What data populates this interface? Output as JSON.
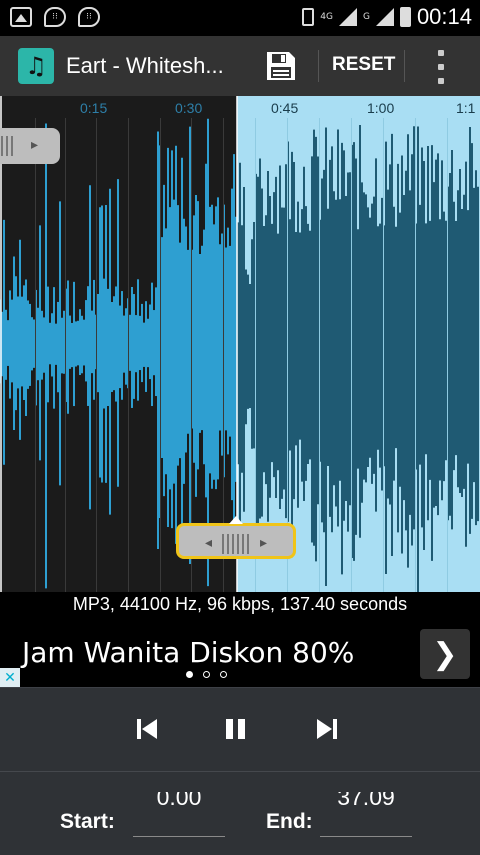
{
  "status_bar": {
    "time": "00:14",
    "network": "4G",
    "network2": "G"
  },
  "app_bar": {
    "title": "Eart - Whitesh...",
    "reset_label": "RESET"
  },
  "timeline": {
    "ticks": [
      "0:15",
      "0:30",
      "0:45",
      "1:00",
      "1:1"
    ]
  },
  "audio_info": "MP3, 44100 Hz, 96 kbps, 137.40 seconds",
  "ad": {
    "text": "Jam Wanita Diskon 80%",
    "close": "✕"
  },
  "editor": {
    "start_label": "Start:",
    "start_value": "0.00",
    "end_label": "End:",
    "end_value": "37.09"
  },
  "colors": {
    "accent": "#2cb6a9",
    "wave_outside": "#2e9fd1",
    "wave_selected": "#1f5a73",
    "selection_bg": "#a9def3",
    "handle_active": "#f0c419"
  }
}
